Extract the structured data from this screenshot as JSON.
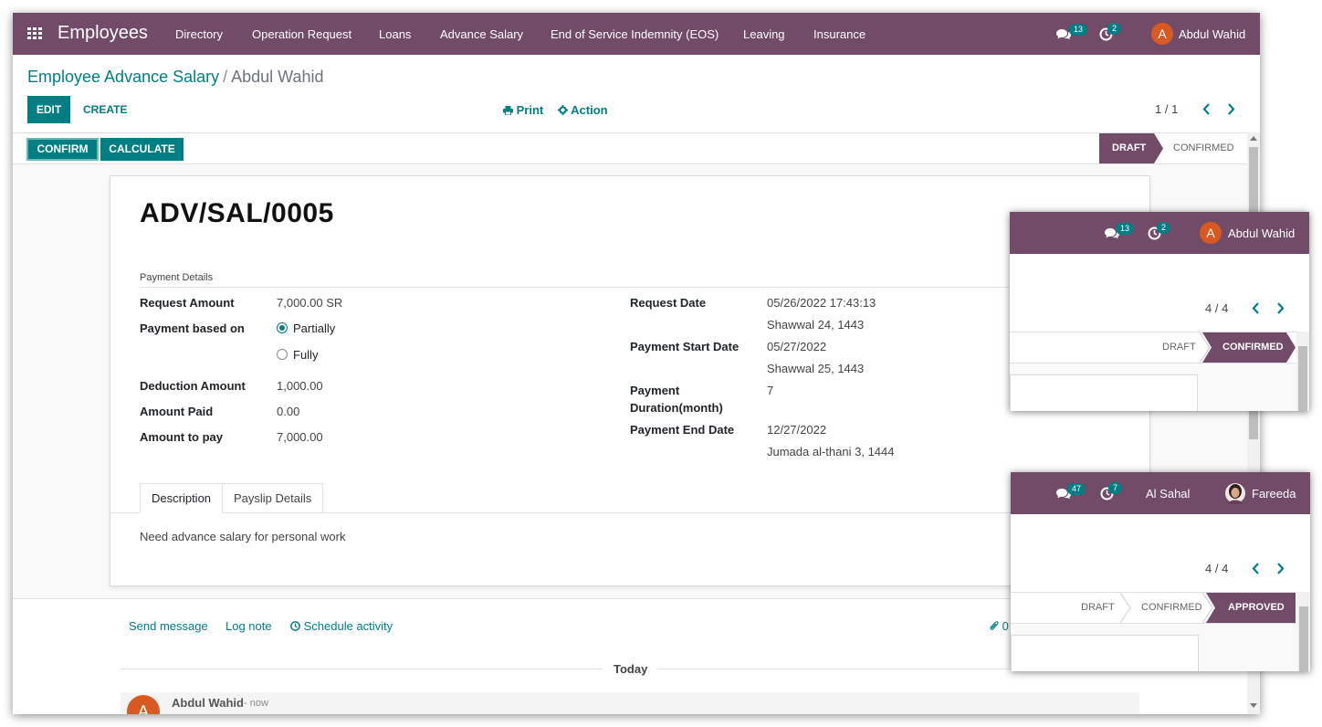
{
  "navbar": {
    "app_name": "Employees",
    "menu": [
      "Directory",
      "Operation Request",
      "Loans",
      "Advance Salary",
      "End of Service Indemnity (EOS)",
      "Leaving",
      "Insurance"
    ],
    "messages_count": "13",
    "activities_count": "2",
    "user_initial": "A",
    "user_name": "Abdul Wahid"
  },
  "breadcrumb": {
    "parent": "Employee Advance Salary",
    "separator": "/",
    "current": "Abdul Wahid"
  },
  "toolbar": {
    "edit": "EDIT",
    "create": "CREATE",
    "print": "Print",
    "action": "Action",
    "pager": "1 / 1"
  },
  "statusbar": {
    "confirm": "CONFIRM",
    "calculate": "CALCULATE",
    "stages": [
      "DRAFT",
      "CONFIRMED"
    ],
    "active_stage": "DRAFT"
  },
  "record": {
    "name": "ADV/SAL/0005",
    "section_title": "Payment Details",
    "request_amount_label": "Request Amount",
    "request_amount": "7,000.00 SR",
    "payment_based_on_label": "Payment based on",
    "option_partially": "Partially",
    "option_fully": "Fully",
    "selected_option": "Partially",
    "deduction_amount_label": "Deduction Amount",
    "deduction_amount": "1,000.00",
    "amount_paid_label": "Amount Paid",
    "amount_paid": "0.00",
    "amount_to_pay_label": "Amount to pay",
    "amount_to_pay": "7,000.00",
    "request_date_label": "Request Date",
    "request_date": "05/26/2022 17:43:13",
    "request_date_hijri": "Shawwal 24, 1443",
    "payment_start_label": "Payment Start Date",
    "payment_start": "05/27/2022",
    "payment_start_hijri": "Shawwal 25, 1443",
    "duration_label_1": "Payment",
    "duration_label_2": "Duration(month)",
    "duration": "7",
    "payment_end_label": "Payment End Date",
    "payment_end": "12/27/2022",
    "payment_end_hijri": "Jumada al-thani 3, 1444"
  },
  "tabs": {
    "description": "Description",
    "payslip": "Payslip Details",
    "description_text": "Need advance salary for personal work"
  },
  "chatter": {
    "send_message": "Send message",
    "log_note": "Log note",
    "schedule_activity": "Schedule activity",
    "attachments": "0",
    "today": "Today",
    "author_initial": "A",
    "author": "Abdul Wahid",
    "time": "- now"
  },
  "inset1": {
    "messages_count": "13",
    "activities_count": "2",
    "user_initial": "A",
    "user_name": "Abdul Wahid",
    "pager": "4 / 4",
    "stages": [
      "DRAFT",
      "CONFIRMED"
    ],
    "active_stage": "CONFIRMED"
  },
  "inset2": {
    "messages_count": "47",
    "activities_count": "7",
    "company": "Al Sahal",
    "user_name": "Fareeda",
    "pager": "4 / 4",
    "stages": [
      "DRAFT",
      "CONFIRMED",
      "APPROVED"
    ],
    "active_stage": "APPROVED"
  },
  "colors": {
    "brand": "#714b67",
    "accent": "#017e84",
    "avatar": "#d85a22"
  }
}
